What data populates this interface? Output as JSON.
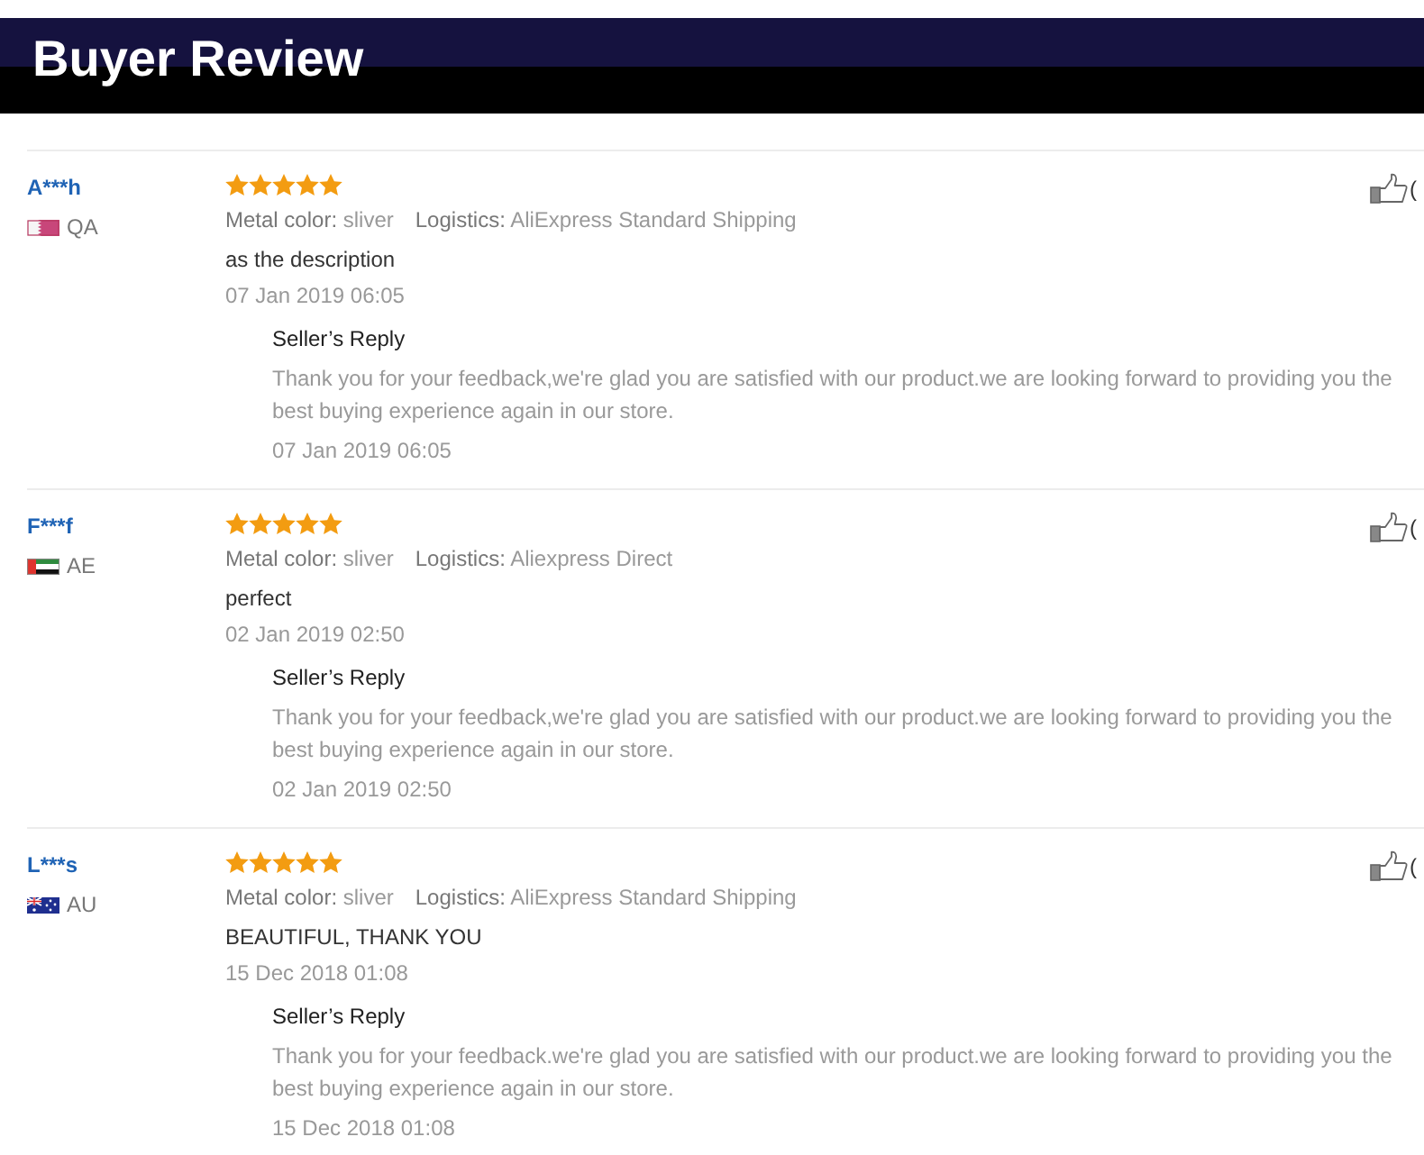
{
  "header": {
    "title": "Buyer Review"
  },
  "reviews": [
    {
      "buyer": "A***h",
      "flag": {
        "kind": "qatar"
      },
      "country": "QA",
      "stars": 5,
      "like_count": "(",
      "attributes": [
        {
          "label": "Metal color:",
          "value": "sliver"
        },
        {
          "label": "Logistics:",
          "value": "AliExpress Standard Shipping"
        }
      ],
      "comment": "as the description",
      "date": "07 Jan 2019 06:05",
      "seller_reply": {
        "title": "Seller’s Reply",
        "text": "Thank you for your feedback,we're glad you are satisfied with our product.we are looking forward to providing you the best buying experience again in our store.",
        "date": "07 Jan 2019 06:05"
      }
    },
    {
      "buyer": "F***f",
      "flag": {
        "kind": "uae"
      },
      "country": "AE",
      "stars": 5,
      "like_count": "(",
      "attributes": [
        {
          "label": "Metal color:",
          "value": "sliver"
        },
        {
          "label": "Logistics:",
          "value": "Aliexpress Direct"
        }
      ],
      "comment": "perfect",
      "date": "02 Jan 2019 02:50",
      "seller_reply": {
        "title": "Seller’s Reply",
        "text": "Thank you for your feedback,we're glad you are satisfied with our product.we are looking forward to providing you the best buying experience again in our store.",
        "date": "02 Jan 2019 02:50"
      }
    },
    {
      "buyer": "L***s",
      "flag": {
        "kind": "australia"
      },
      "country": "AU",
      "stars": 5,
      "like_count": "(",
      "attributes": [
        {
          "label": "Metal color:",
          "value": "sliver"
        },
        {
          "label": "Logistics:",
          "value": "AliExpress Standard Shipping"
        }
      ],
      "comment": "BEAUTIFUL, THANK YOU",
      "date": "15 Dec 2018 01:08",
      "seller_reply": {
        "title": "Seller’s Reply",
        "text": "Thank you for your feedback.we're glad you are satisfied with our product.we are looking forward to providing you the best buying experience again in our store.",
        "date": "15 Dec 2018 01:08"
      }
    }
  ]
}
